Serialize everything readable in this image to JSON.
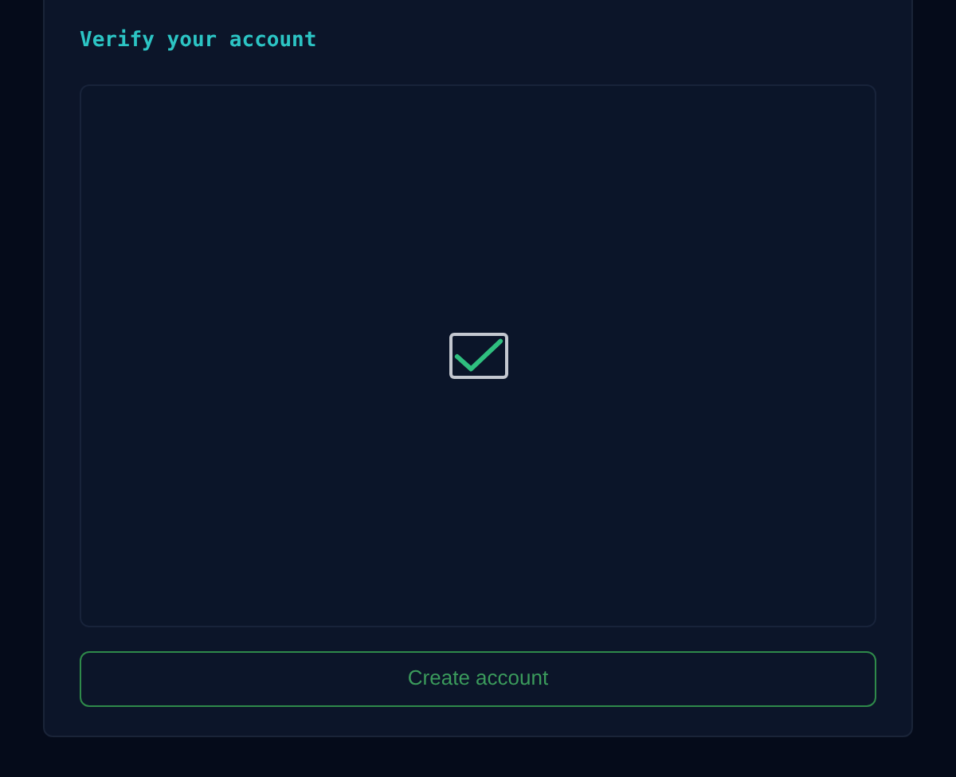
{
  "title": "Verify your account",
  "verification": {
    "checked": true
  },
  "submit_button": "Create account"
}
